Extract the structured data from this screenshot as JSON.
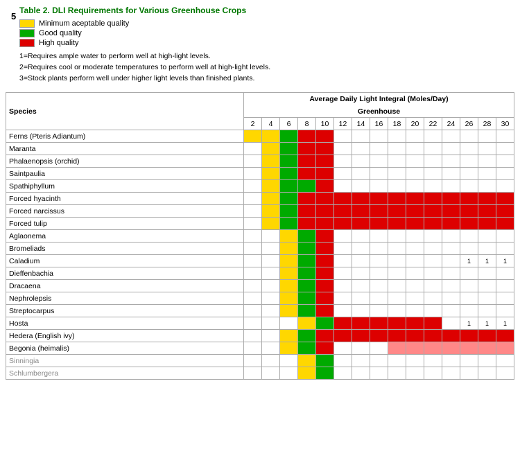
{
  "page": {
    "number": "5",
    "title": "Table 2. DLI Requirements for Various Greenhouse Crops",
    "legend": [
      {
        "color": "#FFD700",
        "label": "Minimum aceptable quality"
      },
      {
        "color": "#00AA00",
        "label": "Good quality"
      },
      {
        "color": "#DD0000",
        "label": "High quality"
      }
    ],
    "notes": [
      "1=Requires ample water to perform well at high-light levels.",
      "2=Requires cool or moderate temperatures to perform well at high-light levels.",
      "3=Stock plants perform well under higher light levels than finished plants."
    ],
    "table": {
      "header_top": "Average Daily Light Integral (Moles/Day)",
      "header_sub": "Greenhouse",
      "species_label": "Species",
      "columns": [
        "2",
        "4",
        "6",
        "8",
        "10",
        "12",
        "14",
        "16",
        "18",
        "20",
        "22",
        "24",
        "26",
        "28",
        "30"
      ],
      "rows": [
        {
          "name": "Ferns (Pteris Adiantum)",
          "gray": false,
          "cells": [
            "Y",
            "Y",
            "G",
            "R",
            "R",
            "W",
            "W",
            "W",
            "W",
            "W",
            "W",
            "W",
            "W",
            "W",
            "W"
          ]
        },
        {
          "name": "Maranta",
          "gray": false,
          "cells": [
            "W",
            "Y",
            "G",
            "R",
            "R",
            "W",
            "W",
            "W",
            "W",
            "W",
            "W",
            "W",
            "W",
            "W",
            "W"
          ]
        },
        {
          "name": "Phalaenopsis (orchid)",
          "gray": false,
          "cells": [
            "W",
            "Y",
            "G",
            "R",
            "R",
            "W",
            "W",
            "W",
            "W",
            "W",
            "W",
            "W",
            "W",
            "W",
            "W"
          ]
        },
        {
          "name": "Saintpaulia",
          "gray": false,
          "cells": [
            "W",
            "Y",
            "G",
            "R",
            "R",
            "W",
            "W",
            "W",
            "W",
            "W",
            "W",
            "W",
            "W",
            "W",
            "W"
          ]
        },
        {
          "name": "Spathiphyllum",
          "gray": false,
          "cells": [
            "W",
            "Y",
            "G",
            "G",
            "R",
            "W",
            "W",
            "W",
            "W",
            "W",
            "W",
            "W",
            "W",
            "W",
            "W"
          ]
        },
        {
          "name": "Forced hyacinth",
          "gray": false,
          "cells": [
            "W",
            "Y",
            "G",
            "R",
            "R",
            "R",
            "R",
            "R",
            "R",
            "R",
            "R",
            "R",
            "R",
            "R",
            "R"
          ]
        },
        {
          "name": "Forced narcissus",
          "gray": false,
          "cells": [
            "W",
            "Y",
            "G",
            "R",
            "R",
            "R",
            "R",
            "R",
            "R",
            "R",
            "R",
            "R",
            "R",
            "R",
            "R"
          ]
        },
        {
          "name": "Forced tulip",
          "gray": false,
          "cells": [
            "W",
            "Y",
            "G",
            "R",
            "R",
            "R",
            "R",
            "R",
            "R",
            "R",
            "R",
            "R",
            "R",
            "R",
            "R"
          ]
        },
        {
          "name": "Aglaonema",
          "gray": false,
          "cells": [
            "W",
            "W",
            "Y",
            "G",
            "R",
            "W",
            "W",
            "W",
            "W",
            "W",
            "W",
            "W",
            "W",
            "W",
            "W"
          ]
        },
        {
          "name": "Bromeliads",
          "gray": false,
          "cells": [
            "W",
            "W",
            "Y",
            "G",
            "R",
            "W",
            "W",
            "W",
            "W",
            "W",
            "W",
            "W",
            "W",
            "W",
            "W"
          ]
        },
        {
          "name": "Caladium",
          "gray": false,
          "cells": [
            "W",
            "W",
            "Y",
            "G",
            "R",
            "W",
            "W",
            "W",
            "W",
            "W",
            "W",
            "W",
            "1",
            "1",
            "1"
          ]
        },
        {
          "name": "Dieffenbachia",
          "gray": false,
          "cells": [
            "W",
            "W",
            "Y",
            "G",
            "R",
            "W",
            "W",
            "W",
            "W",
            "W",
            "W",
            "W",
            "W",
            "W",
            "W"
          ]
        },
        {
          "name": "Dracaena",
          "gray": false,
          "cells": [
            "W",
            "W",
            "Y",
            "G",
            "R",
            "W",
            "W",
            "W",
            "W",
            "W",
            "W",
            "W",
            "W",
            "W",
            "W"
          ]
        },
        {
          "name": "Nephrolepsis",
          "gray": false,
          "cells": [
            "W",
            "W",
            "Y",
            "G",
            "R",
            "W",
            "W",
            "W",
            "W",
            "W",
            "W",
            "W",
            "W",
            "W",
            "W"
          ]
        },
        {
          "name": "Streptocarpus",
          "gray": false,
          "cells": [
            "W",
            "W",
            "Y",
            "G",
            "R",
            "W",
            "W",
            "W",
            "W",
            "W",
            "W",
            "W",
            "W",
            "W",
            "W"
          ]
        },
        {
          "name": "Hosta",
          "gray": false,
          "cells": [
            "W",
            "W",
            "W",
            "Y",
            "G",
            "R",
            "R",
            "R",
            "R",
            "R",
            "R",
            "W",
            "1",
            "1",
            "1"
          ]
        },
        {
          "name": "Hedera (English ivy)",
          "gray": false,
          "cells": [
            "W",
            "W",
            "Y",
            "G",
            "R",
            "R",
            "R",
            "R",
            "R",
            "R",
            "R",
            "R",
            "R",
            "R",
            "R"
          ]
        },
        {
          "name": "Begonia (heimalis)",
          "gray": false,
          "cells": [
            "W",
            "W",
            "Y",
            "G",
            "R",
            "W",
            "W",
            "W",
            "LR",
            "LR",
            "LR",
            "LR",
            "LR",
            "LR",
            "LR"
          ]
        },
        {
          "name": "Sinningia",
          "gray": true,
          "cells": [
            "W",
            "W",
            "W",
            "Y",
            "G",
            "W",
            "W",
            "W",
            "W",
            "W",
            "W",
            "W",
            "W",
            "W",
            "W"
          ]
        },
        {
          "name": "Schlumbergera",
          "gray": true,
          "cells": [
            "W",
            "W",
            "W",
            "Y",
            "G",
            "W",
            "W",
            "W",
            "W",
            "W",
            "W",
            "W",
            "W",
            "W",
            "W"
          ]
        }
      ]
    }
  }
}
